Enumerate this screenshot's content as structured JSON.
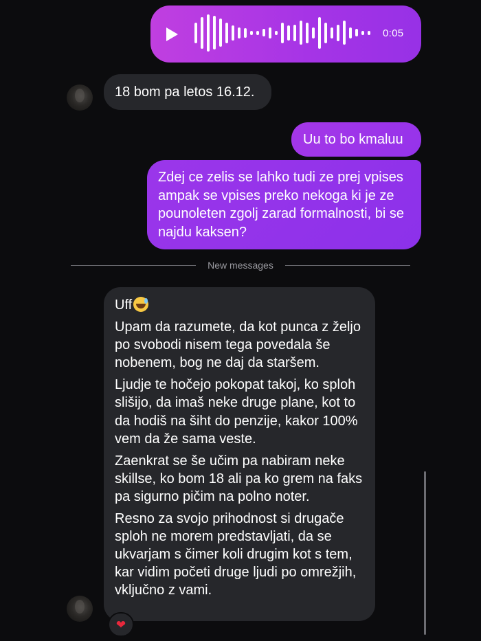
{
  "voice_message": {
    "duration": "0:05",
    "waveform_levels": [
      0.55,
      0.85,
      1.0,
      0.9,
      0.75,
      0.55,
      0.4,
      0.3,
      0.25,
      0.1,
      0.12,
      0.2,
      0.3,
      0.12,
      0.55,
      0.4,
      0.45,
      0.65,
      0.55,
      0.3,
      0.85,
      0.55,
      0.3,
      0.45,
      0.65,
      0.3,
      0.2,
      0.12,
      0.1
    ]
  },
  "messages": {
    "incoming_1": "18 bom pa letos 16.12.",
    "outgoing_1": "Uu to bo kmaluu",
    "outgoing_2": "Zdej ce zelis se lahko tudi ze prej vpises ampak se vpises preko nekoga ki je ze pounoleten zgolj zarad formalnosti, bi se najdu kaksen?",
    "divider": "New messages",
    "incoming_2": {
      "line_1": "Uff",
      "paragraph_1": "Upam da razumete, da kot punca z željo po svobodi nisem tega povedala še nobenem, bog ne daj da staršem.",
      "paragraph_2": "Ljudje te hočejo pokopat takoj, ko sploh slišijo, da imaš neke druge plane, kot to da hodiš na šiht do penzije, kakor 100% vem da že sama veste.",
      "paragraph_3": "Zaenkrat se še učim pa nabiram neke skillse, ko bom 18 ali pa ko grem na faks pa sigurno pičim na polno noter.",
      "paragraph_4": "Resno za svojo prihodnost si drugače sploh ne morem predstavljati, da se ukvarjam s čimer koli drugim kot s tem, kar vidim početi druge ljudi po omrežjih, vključno z vami."
    },
    "reaction": "❤"
  },
  "colors": {
    "outgoing_accent": "#9a2ee6",
    "incoming_bubble": "#26272b",
    "background": "#0c0c0e"
  },
  "icons": {
    "play": "play-icon",
    "emoji": "grinning-sweat-emoji",
    "reaction": "red-heart"
  }
}
